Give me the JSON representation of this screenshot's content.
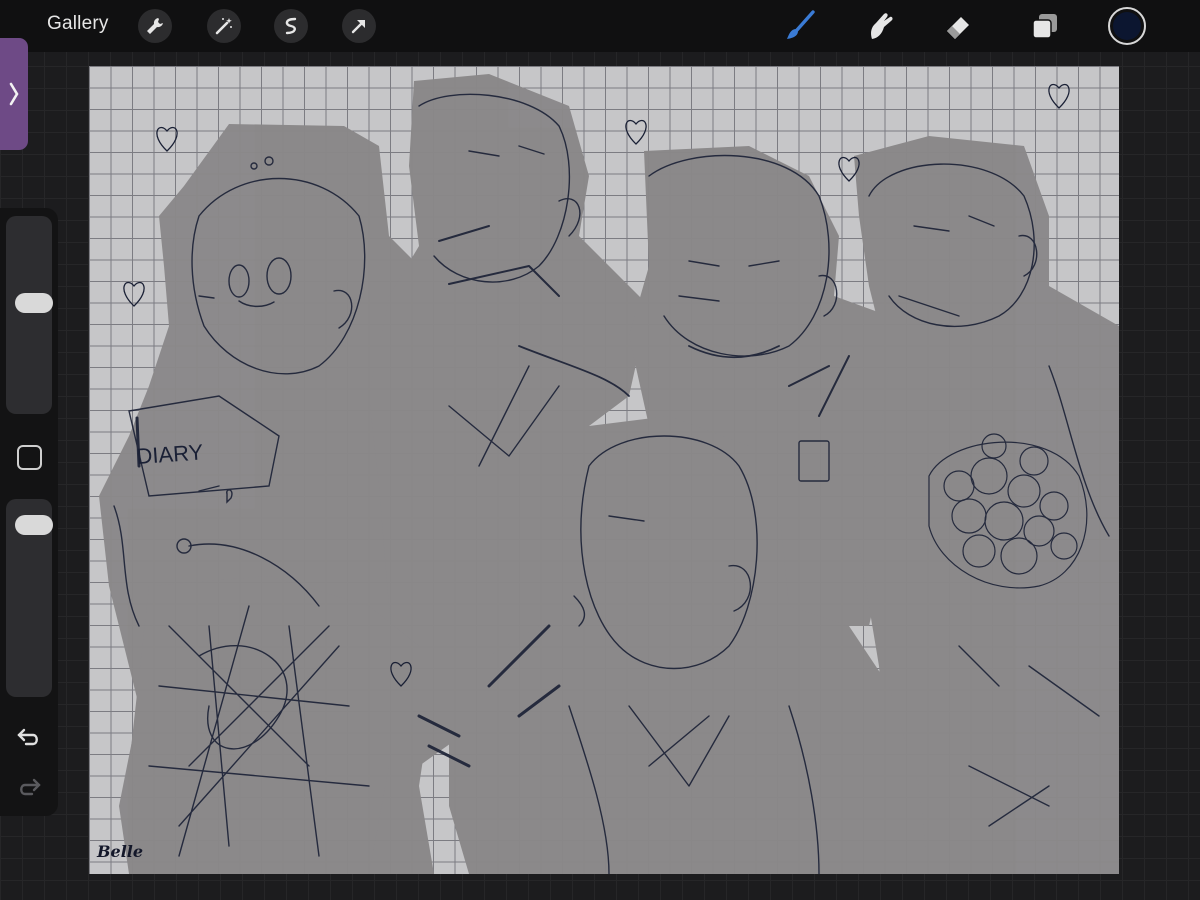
{
  "toolbar": {
    "gallery_label": "Gallery",
    "left_tools": [
      "wrench-icon",
      "magic-wand-icon",
      "selection-icon",
      "transform-arrow-icon"
    ],
    "right_tools": [
      "brush-icon",
      "smudge-icon",
      "eraser-icon",
      "layers-icon"
    ],
    "active_tool": "brush-icon",
    "active_tool_color": "#3a7bd5",
    "current_color": "#0c1630"
  },
  "sidebar": {
    "brush_size_fraction": 0.57,
    "opacity_fraction": 0.93,
    "icons": [
      "chevron-right-icon",
      "modify-square-icon",
      "undo-icon",
      "redo-icon"
    ]
  },
  "canvas": {
    "background_color": "#c6c6c8",
    "figure_fill": "#8a8889",
    "line_color": "#1a2035",
    "diary_label": "DIARY",
    "signature": "Belle"
  }
}
